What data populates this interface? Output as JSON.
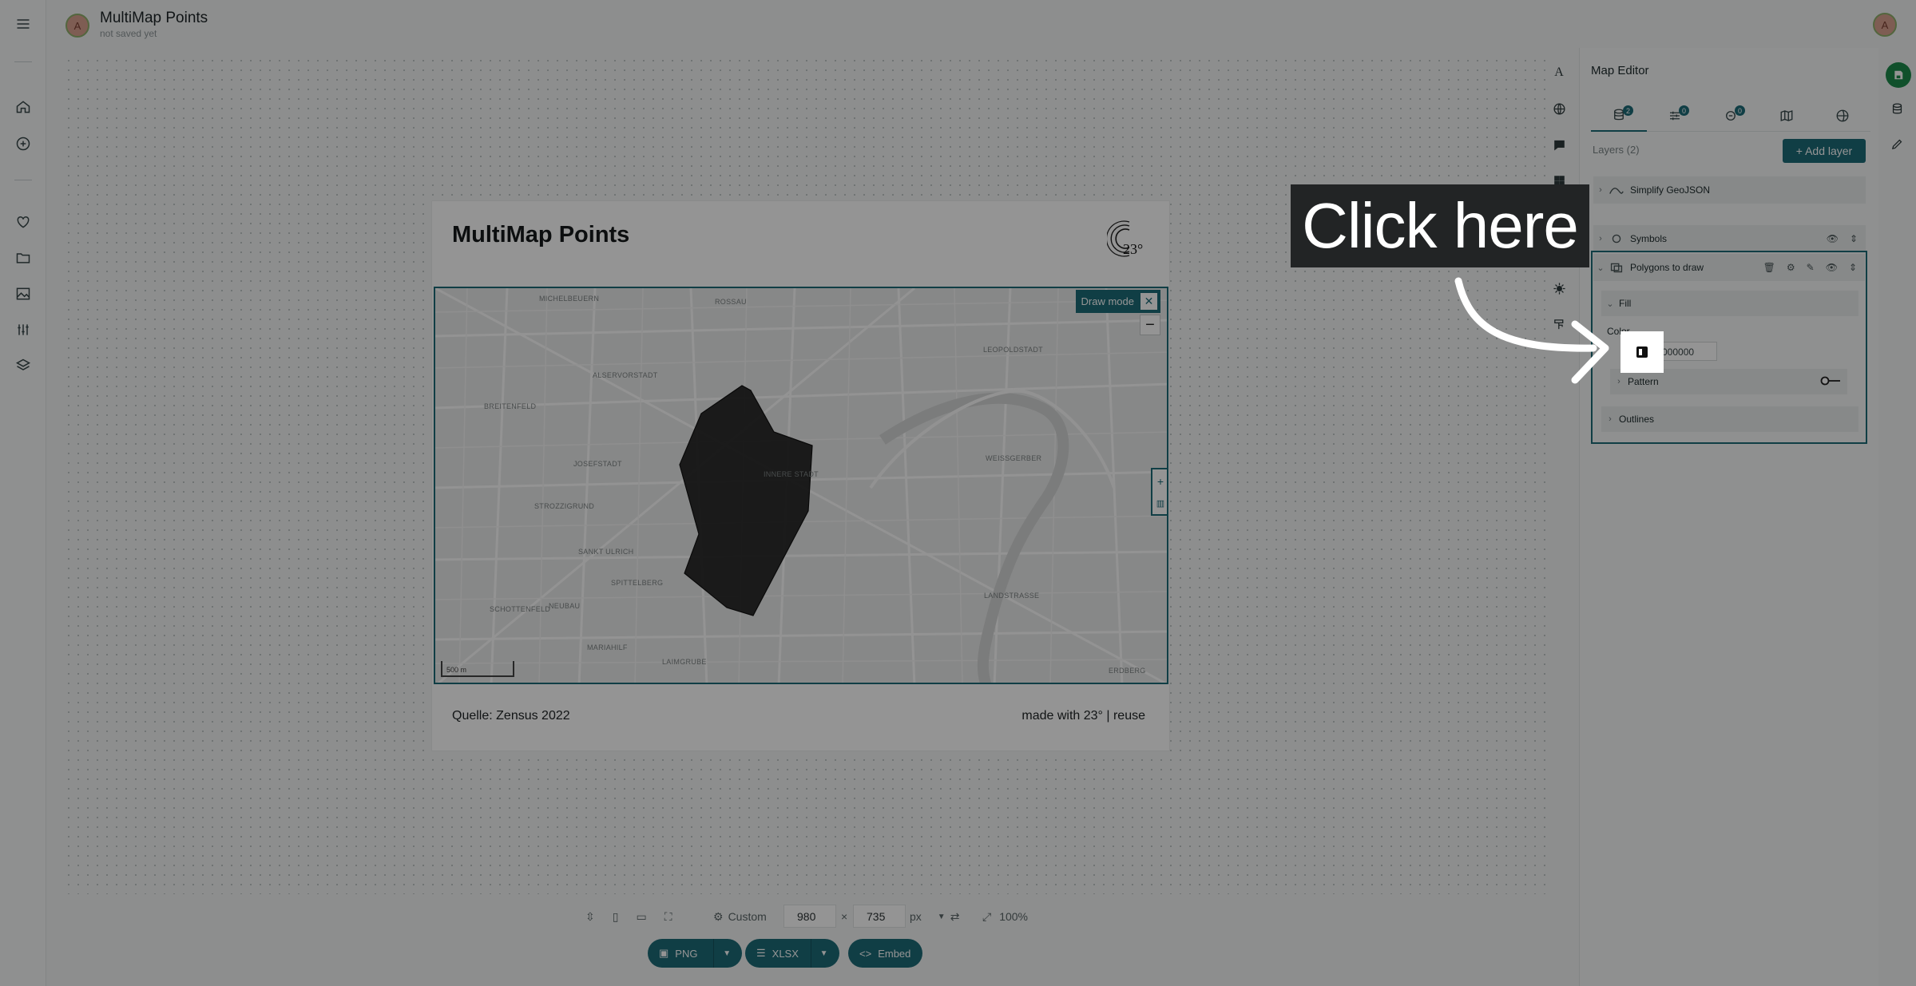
{
  "app": {
    "doc_title": "MultiMap Points",
    "doc_subtitle": "not saved yet",
    "avatar_letter": "A"
  },
  "card": {
    "title": "MultiMap Points",
    "logo_text": "23°",
    "source": "Quelle: Zensus 2022",
    "made_with": "made with 23° | reuse"
  },
  "map": {
    "draw_mode_label": "Draw mode",
    "close_symbol": "✕",
    "zoom_in": "+",
    "zoom_out": "−",
    "scale_label": "500 m",
    "side_plus": "+",
    "side_trash": "🗑",
    "labels": [
      "MICHELBEUERN",
      "ROSSAU",
      "ALSERVORSTADT",
      "BREITENFELD",
      "LEOPOLDSTADT",
      "JOSEFSTADT",
      "INNERE STADT",
      "WEISSGERBER",
      "STROZZIGRUND",
      "SANKT ULRICH",
      "SPITTELBERG",
      "SCHOTTENFELD",
      "NEUBAU",
      "LANDSTRASSE",
      "MARIAHILF",
      "LAIMGRUBE",
      "ERDBERG"
    ]
  },
  "bottom_toolbar": {
    "preset": "Custom",
    "width": "980",
    "times": "×",
    "height": "735",
    "unit": "px",
    "zoom": "100%",
    "png_label": "PNG",
    "xlsx_label": "XLSX",
    "embed_label": "Embed"
  },
  "editor": {
    "title": "Map Editor",
    "tab_badges": [
      "2",
      "0",
      "0"
    ],
    "layers_label": "Layers (2)",
    "add_layer": "+ Add layer",
    "layers": [
      {
        "name": "Simplify GeoJSON"
      },
      {
        "name": "Symbols"
      },
      {
        "name": "Polygons to draw"
      }
    ],
    "fill_label": "Fill",
    "color_label": "Color",
    "color_value": "000000",
    "pattern_label": "Pattern",
    "outlines_label": "Outlines"
  },
  "overlay": {
    "callout": "Click here"
  },
  "colors": {
    "accent": "#1c6b78",
    "polygon_fill": "#1a1a1a",
    "save_green": "#1d8a4a"
  }
}
